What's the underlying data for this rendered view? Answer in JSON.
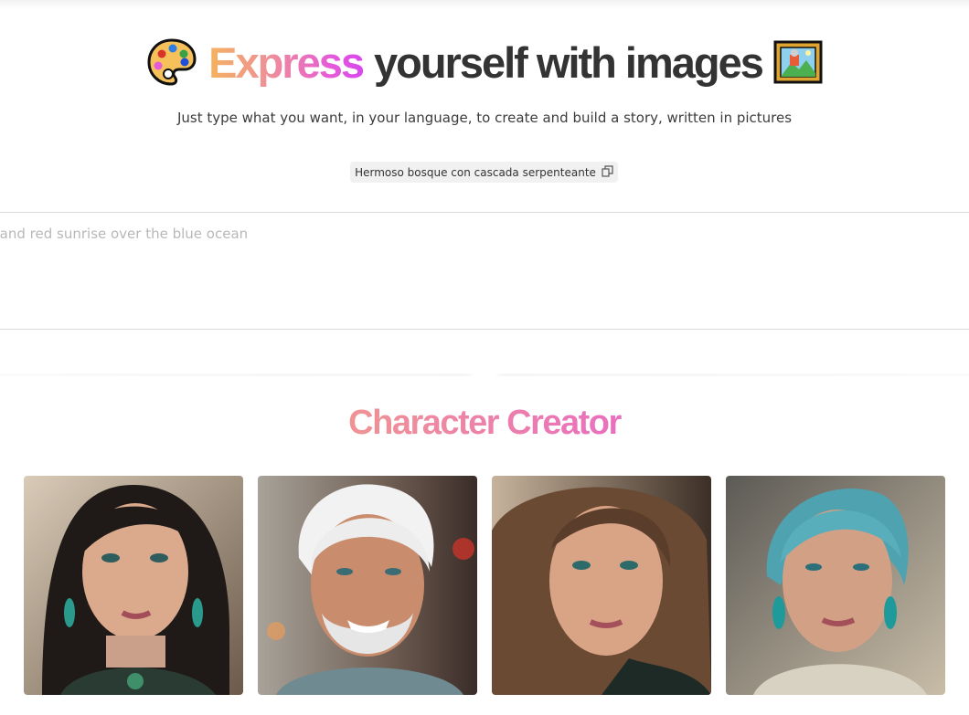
{
  "hero": {
    "title_gradient": "Express",
    "title_rest": "yourself with images",
    "leading_icon": "palette-icon",
    "trailing_icon": "framed-picture-icon",
    "subtitle": "Just type what you want, in your language, to create and build a story, written in pictures"
  },
  "example_chip": {
    "label": "Hermoso bosque con cascada serpenteante",
    "icon": "copy-icon"
  },
  "prompt": {
    "placeholder": "A yellow and red sunrise over the blue ocean"
  },
  "character_section": {
    "title": "Character Creator",
    "cards": [
      {
        "name": "character-dark-bob-woman",
        "icon": "portrait-image"
      },
      {
        "name": "character-white-haired-man",
        "icon": "portrait-image"
      },
      {
        "name": "character-brown-haired-woman",
        "icon": "portrait-image"
      },
      {
        "name": "character-teal-haired-woman",
        "icon": "portrait-image"
      }
    ]
  },
  "colors": {
    "gradient_start": "#f4b35e",
    "gradient_end": "#d946ef",
    "text": "#333333",
    "chip_bg": "#f1f1f1",
    "border": "#d9d9d9"
  }
}
